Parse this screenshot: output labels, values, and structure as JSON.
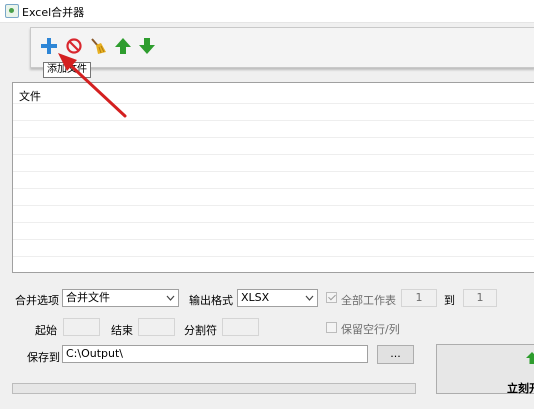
{
  "window": {
    "title": "Excel合并器"
  },
  "toolbar": {
    "buttons": [
      {
        "icon": "plus-icon",
        "color": "#2e86d6"
      },
      {
        "icon": "no-entry-icon",
        "color": "#d9272e"
      },
      {
        "icon": "broom-icon",
        "color": "#e0a020"
      },
      {
        "icon": "arrow-up-icon",
        "color": "#2e9d2e"
      },
      {
        "icon": "arrow-down-icon",
        "color": "#2e9d2e"
      }
    ],
    "tooltip": "添加文件"
  },
  "file_list": {
    "header": "文件",
    "rows": []
  },
  "options": {
    "merge_option_label": "合并选项",
    "merge_option_value": "合并文件",
    "output_format_label": "输出格式",
    "output_format_value": "XLSX",
    "all_sheets_label": "全部工作表",
    "all_sheets_checked": true,
    "sheet_from": "1",
    "to_label": "到",
    "sheet_to": "1",
    "start_label": "起始",
    "start_value": "",
    "end_label": "结束",
    "end_value": "",
    "separator_label": "分割符",
    "separator_value": "",
    "keep_blank_label": "保留空行/列",
    "keep_blank_checked": false,
    "save_to_label": "保存到",
    "save_to_value": "C:\\Output\\",
    "browse_label": "..."
  },
  "progress": {
    "value": 0
  },
  "action": {
    "merge_label": "立刻开"
  },
  "colors": {
    "annotation_arrow": "#d42020"
  }
}
